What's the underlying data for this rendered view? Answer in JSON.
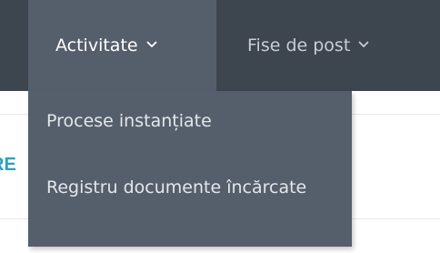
{
  "nav": {
    "tabs": [
      {
        "label": "Activitate",
        "icon": "chevron-down-icon",
        "active": true
      },
      {
        "label": "Fise de post",
        "icon": "chevron-down-icon",
        "active": false
      }
    ]
  },
  "dropdown": {
    "items": [
      {
        "label": "Procese instanțiate"
      },
      {
        "label": "Registru documente încărcate"
      }
    ]
  },
  "content": {
    "partial_heading": "RE"
  },
  "colors": {
    "topbar": "#3d454f",
    "active_tab": "#555f6b",
    "dropdown": "#555f6b",
    "accent": "#2b9fc0"
  }
}
